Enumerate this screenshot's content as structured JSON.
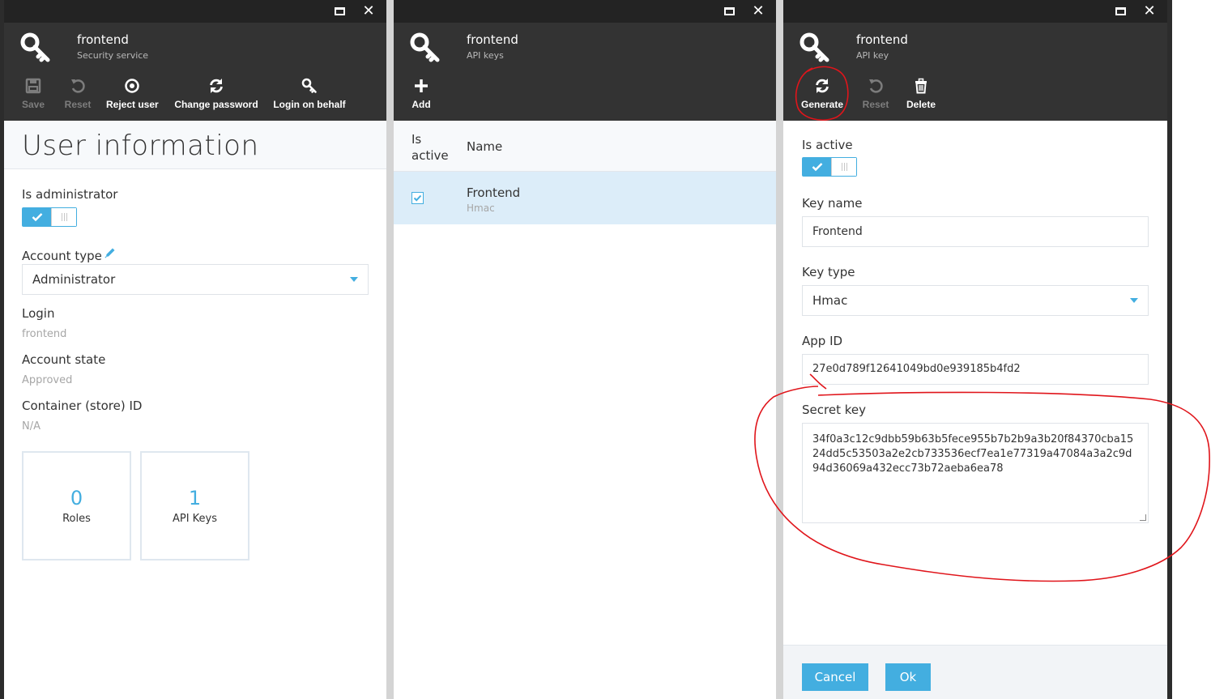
{
  "blades": {
    "security": {
      "title": "frontend",
      "subtitle": "Security service",
      "toolbar": {
        "save": "Save",
        "reset": "Reset",
        "reject_user": "Reject user",
        "change_password": "Change password",
        "login_on_behalf": "Login on behalf"
      },
      "page_title": "User information",
      "is_administrator_label": "Is administrator",
      "is_administrator": true,
      "account_type_label": "Account type",
      "account_type_value": "Administrator",
      "login_label": "Login",
      "login_value": "frontend",
      "account_state_label": "Account state",
      "account_state_value": "Approved",
      "container_label": "Container (store) ID",
      "container_value": "N/A",
      "tiles": [
        {
          "count": "0",
          "label": "Roles"
        },
        {
          "count": "1",
          "label": "API Keys"
        }
      ]
    },
    "api_keys": {
      "title": "frontend",
      "subtitle": "API keys",
      "toolbar": {
        "add": "Add"
      },
      "columns": {
        "is_active": "Is active",
        "name": "Name"
      },
      "rows": [
        {
          "is_active": true,
          "name": "Frontend",
          "type": "Hmac"
        }
      ]
    },
    "api_key": {
      "title": "frontend",
      "subtitle": "API key",
      "toolbar": {
        "generate": "Generate",
        "reset": "Reset",
        "delete": "Delete"
      },
      "is_active_label": "Is active",
      "is_active": true,
      "key_name_label": "Key name",
      "key_name_value": "Frontend",
      "key_type_label": "Key type",
      "key_type_value": "Hmac",
      "app_id_label": "App ID",
      "app_id_value": "27e0d789f12641049bd0e939185b4fd2",
      "secret_key_label": "Secret key",
      "secret_key_value": "34f0a3c12c9dbb59b63b5fece955b7b2b9a3b20f84370cba1524dd5c53503a2e2cb733536ecf7ea1e77319a47084a3a2c9d94d36069a432ecc73b72aeba6ea78",
      "cancel": "Cancel",
      "ok": "Ok"
    }
  },
  "colors": {
    "accent": "#43aee0",
    "header": "#333333",
    "annotation": "#e0151b"
  }
}
